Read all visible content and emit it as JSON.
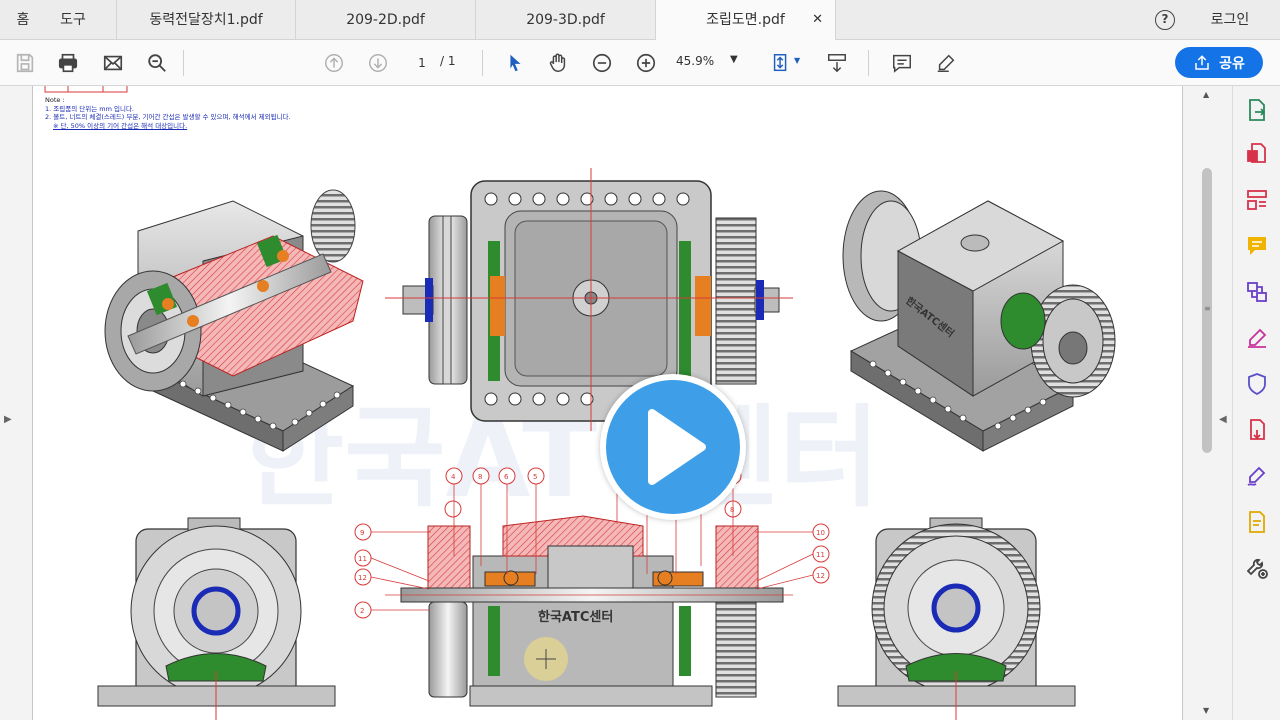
{
  "nav": {
    "home": "홈",
    "tools": "도구"
  },
  "tabs": [
    {
      "label": "동력전달장치1.pdf"
    },
    {
      "label": "209-2D.pdf"
    },
    {
      "label": "209-3D.pdf"
    },
    {
      "label": "조립도면.pdf",
      "active": true
    }
  ],
  "help": "?",
  "login": "로그인",
  "toolbar": {
    "page_current": "1",
    "page_total": "/ 1",
    "zoom": "45.9%",
    "share_label": "공유"
  },
  "notes": {
    "title": "Note :",
    "line1": "1. 조립품의 단위는 mm 입니다.",
    "line2": "2. 볼트, 너트의 체결(스레드) 부분, 기어간 간섭은 발생할 수 있으며, 해석에서 제외됩니다.",
    "line3": "※ 단, 50% 이상의 기어 간섭은 해석 대상입니다."
  },
  "drawing": {
    "watermark": "한국ATC센터",
    "callouts": [
      "4",
      "8",
      "6",
      "5",
      "1",
      "5",
      "6",
      "4",
      "8",
      "9",
      "10",
      "11",
      "12",
      "2",
      "11",
      "12"
    ]
  },
  "colors": {
    "accent": "#1473e6",
    "play": "#3e9fe8",
    "section_red": "#d83a3a",
    "note_blue": "#1a2bb5"
  }
}
